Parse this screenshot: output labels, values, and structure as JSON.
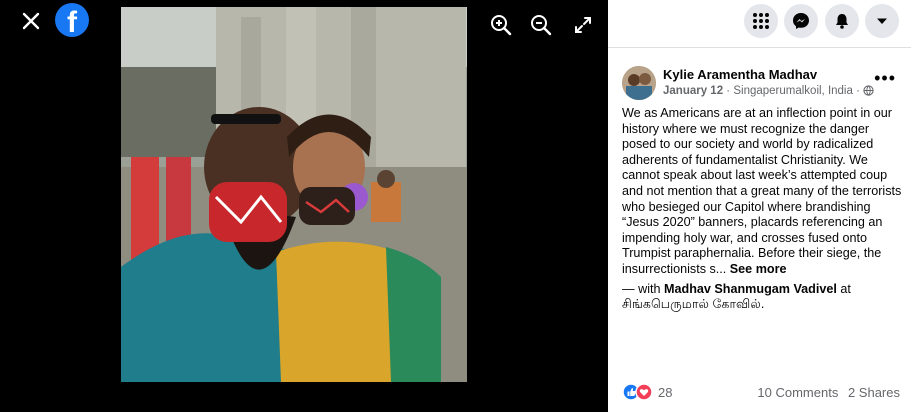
{
  "viewer": {
    "close_icon": "close-icon",
    "brand_icon": "facebook-logo",
    "logo_letter": "f",
    "tools": [
      "zoom-in-icon",
      "zoom-out-icon",
      "fullscreen-icon"
    ]
  },
  "topbar": {
    "icons": [
      "menu-grid-icon",
      "messenger-icon",
      "notifications-bell-icon",
      "account-caret-icon"
    ]
  },
  "post": {
    "author": "Kylie Aramentha Madhav",
    "date": "January 12",
    "separator": " · ",
    "location": "Singaperumalkoil, India",
    "location_sep": " · ",
    "body": "We as Americans are at an inflection point in our history where we must recognize the danger posed to our society and world by radicalized adherents of fundamentalist Christianity. We cannot speak about last week’s attempted coup and not mention that a great many of the terrorists who besieged our Capitol where brandishing “Jesus 2020” banners, placards referencing an impending holy war, and crosses fused onto Trumpist paraphernalia. Before their siege, the insurrectionists s...",
    "see_more": "See more",
    "with_prefix": "— with ",
    "with_person": "Madhav Shanmugam Vadivel",
    "at_word": " at ",
    "place": "சிங்கபெருமால் கோவில்.",
    "reaction_count": "28",
    "comments": "10 Comments",
    "shares": "2 Shares"
  },
  "colors": {
    "brand": "#1877f2",
    "like": "#1877f2",
    "love": "#f33e58"
  }
}
